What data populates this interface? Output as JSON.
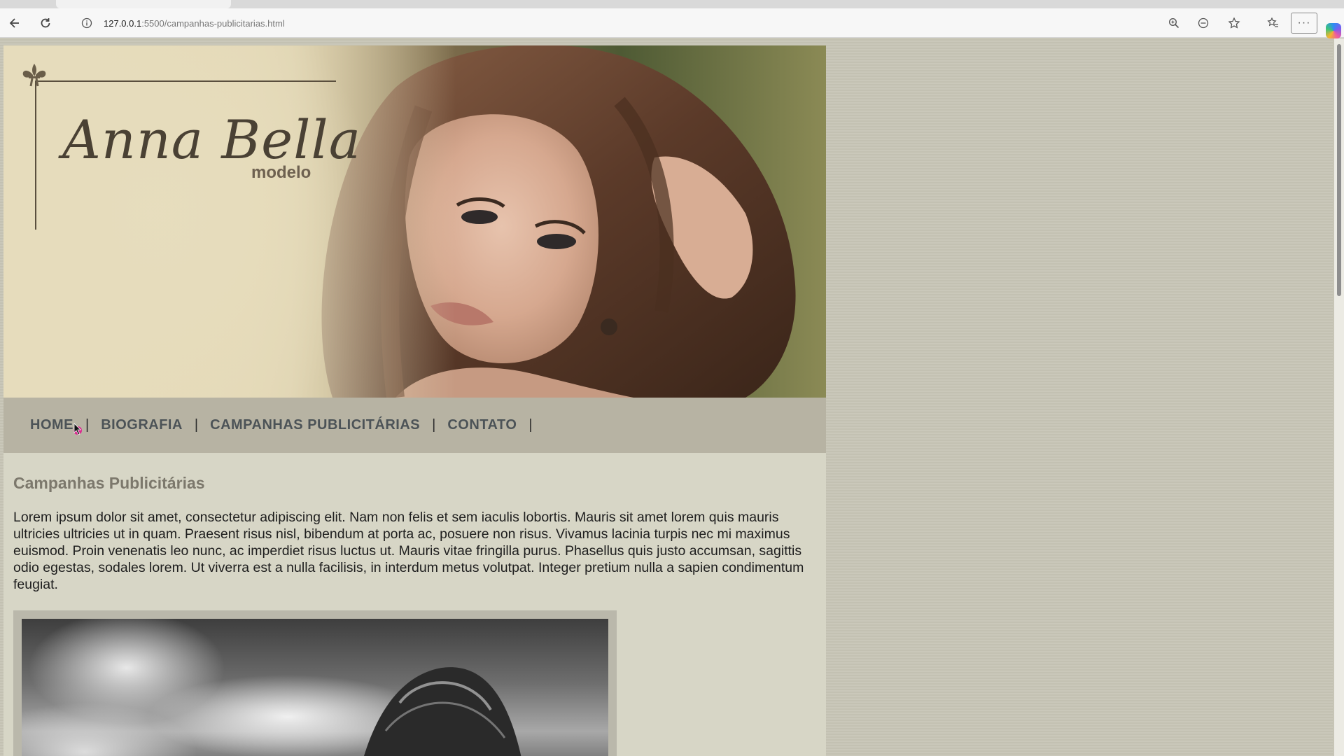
{
  "browser": {
    "url_host": "127.0.0.1",
    "url_path": ":5500/campanhas-publicitarias.html",
    "menu_label": "···"
  },
  "header": {
    "logo_name": "Anna Bella",
    "logo_subtitle": "modelo"
  },
  "nav": {
    "items": [
      {
        "label": "HOME"
      },
      {
        "label": "BIOGRAFIA"
      },
      {
        "label": "CAMPANHAS PUBLICITÁRIAS"
      },
      {
        "label": "CONTATO"
      }
    ],
    "separator": "|"
  },
  "content": {
    "title": "Campanhas Publicitárias",
    "paragraph": "Lorem ipsum dolor sit amet, consectetur adipiscing elit. Nam non felis et sem iaculis lobortis. Mauris sit amet lorem quis mauris ultricies ultricies ut in quam. Praesent risus nisl, bibendum at porta ac, posuere non risus. Vivamus lacinia turpis nec mi maximus euismod. Proin venenatis leo nunc, ac imperdiet risus luctus ut. Mauris vitae fringilla purus. Phasellus quis justo accumsan, sagittis odio egestas, sodales lorem. Ut viverra est a nulla facilisis, in interdum metus volutpat. Integer pretium nulla a sapien condimentum feugiat."
  },
  "colors": {
    "page_background": "#c7c5b6",
    "nav_background": "#b7b3a3",
    "content_background": "#d7d6c6",
    "nav_link": "#4c5357",
    "heading": "#7c786c"
  },
  "icons": [
    "back-arrow-icon",
    "reload-icon",
    "site-info-icon",
    "zoom-icon",
    "reader-icon",
    "star-icon",
    "favorites-icon",
    "more-icon",
    "copilot-icon",
    "fleur-de-lis-icon",
    "cursor-icon"
  ]
}
